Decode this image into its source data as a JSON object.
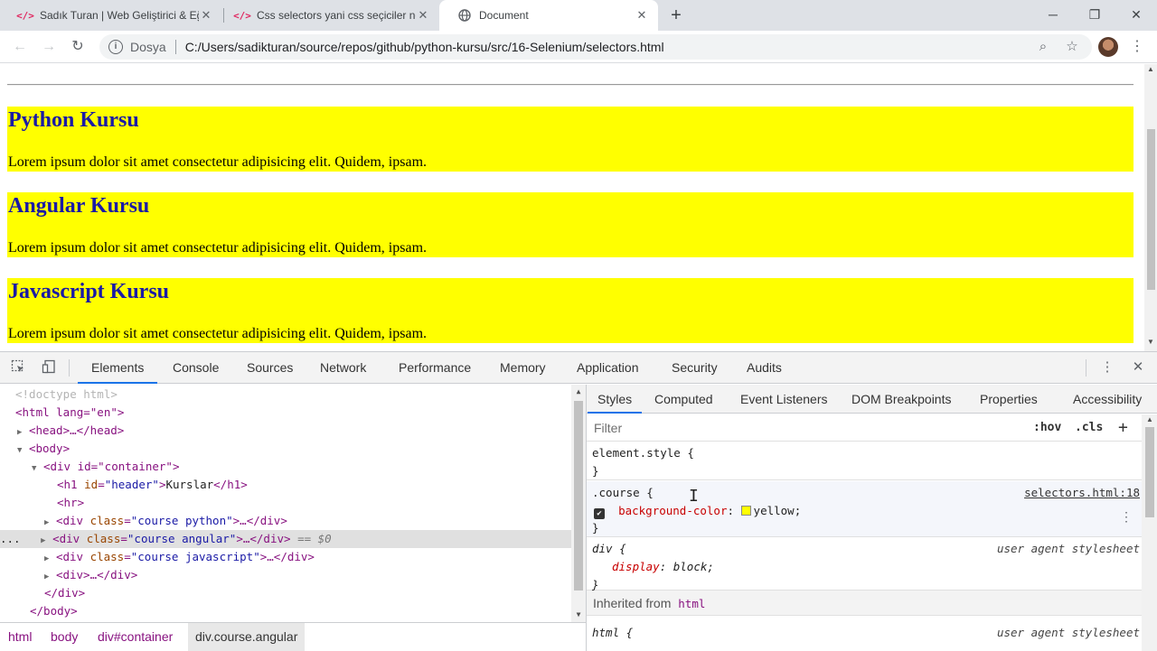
{
  "browser": {
    "tabs": [
      {
        "icon": "code-icon",
        "label": "Sadık Turan | Web Geliştirici & Eğ",
        "active": false
      },
      {
        "icon": "code-icon",
        "label": "Css selectors yani css seçiciler ne",
        "active": false
      },
      {
        "icon": "globe-icon",
        "label": "Document",
        "active": true
      }
    ],
    "new_tab": "+",
    "address": {
      "scheme": "Dosya",
      "url": "C:/Users/sadikturan/source/repos/github/python-kursu/src/16-Selenium/selectors.html"
    }
  },
  "page": {
    "courses": [
      {
        "title": "Python Kursu",
        "text": "Lorem ipsum dolor sit amet consectetur adipisicing elit. Quidem, ipsam."
      },
      {
        "title": "Angular Kursu",
        "text": "Lorem ipsum dolor sit amet consectetur adipisicing elit. Quidem, ipsam."
      },
      {
        "title": "Javascript Kursu",
        "text": "Lorem ipsum dolor sit amet consectetur adipisicing elit. Quidem, ipsam."
      }
    ],
    "background_color": "#ffff00",
    "heading_color": "#1a1aa6"
  },
  "devtools": {
    "tabs": [
      "Elements",
      "Console",
      "Sources",
      "Network",
      "Performance",
      "Memory",
      "Application",
      "Security",
      "Audits"
    ],
    "active_tab": "Elements",
    "dom": {
      "doctype": "<!doctype html>",
      "html_open": "<html lang=\"en\">",
      "head": "<head>…</head>",
      "body_open": "<body>",
      "container_open": "<div id=\"container\">",
      "h1_tag": "h1",
      "h1_attr": "id",
      "h1_val": "\"header\"",
      "h1_text": "Kurslar",
      "hr": "<hr>",
      "div_python_class": "\"course python\"",
      "div_angular_class": "\"course angular\"",
      "div_js_class": "\"course javascript\"",
      "div_plain": "<div>…</div>",
      "div_close": "</div>",
      "body_close": "</body>",
      "ellipsis_close": ">…</div>",
      "selected_marker": "== $0",
      "gutter_dots": "..."
    },
    "breadcrumb": [
      "html",
      "body",
      "div#container",
      "div.course.angular"
    ],
    "styles": {
      "tabs": [
        "Styles",
        "Computed",
        "Event Listeners",
        "DOM Breakpoints",
        "Properties",
        "Accessibility"
      ],
      "active_tab": "Styles",
      "filter_placeholder": "Filter",
      "hov": ":hov",
      "cls": ".cls",
      "plus": "+",
      "element_style_open": "element.style {",
      "close_brace": "}",
      "course_selector": ".course {",
      "course_source": "selectors.html:18",
      "course_prop": "background-color",
      "course_value": "yellow;",
      "div_selector": "div {",
      "div_source": "user agent stylesheet",
      "div_prop": "display",
      "div_value": "block;",
      "inherited_label": "Inherited from",
      "inherited_tag": "html",
      "html_selector": "html {",
      "html_source": "user agent stylesheet"
    }
  }
}
